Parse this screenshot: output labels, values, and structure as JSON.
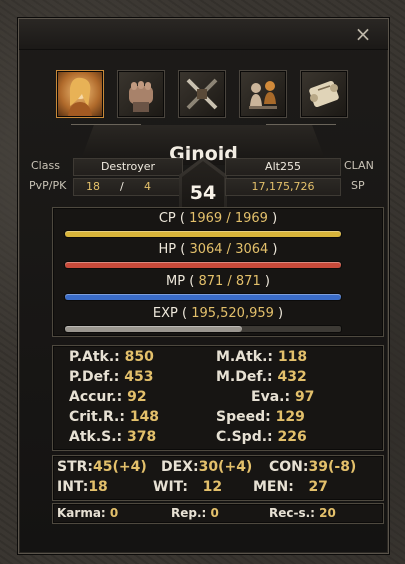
{
  "window": {
    "close_label": "×"
  },
  "tabs": [
    {
      "name": "character-portrait",
      "active": true
    },
    {
      "name": "fist",
      "active": false
    },
    {
      "name": "crossed-weapons",
      "active": false
    },
    {
      "name": "pawns",
      "active": false
    },
    {
      "name": "scroll",
      "active": false
    }
  ],
  "character": {
    "name": "Ginoid",
    "class_label": "Class",
    "class_value": "Destroyer",
    "pvppk_label": "PvP/PK",
    "pvp": "18",
    "pk_separator": "/",
    "pk": "4",
    "level": "54",
    "clan_value": "Alt255",
    "clan_label": "CLAN",
    "sp_value": "17,175,726",
    "sp_label": "SP"
  },
  "bars": {
    "cp": {
      "label": "CP (",
      "value": "1969 / 1969",
      "close": ")",
      "fraction": 1.0,
      "color": "#d8b43a"
    },
    "hp": {
      "label": "HP (",
      "value": "3064 / 3064",
      "close": ")",
      "fraction": 1.0,
      "color": "#c84a3a"
    },
    "mp": {
      "label": "MP (",
      "value": "871 / 871",
      "close": ")",
      "fraction": 1.0,
      "color": "#3a6cc8"
    },
    "exp": {
      "label": "EXP (",
      "value": "195,520,959",
      "close": ")",
      "fraction": 0.64,
      "color": "#9a968f"
    }
  },
  "combat": {
    "patk": {
      "label": "P.Atk.:",
      "value": "850"
    },
    "matk": {
      "label": "M.Atk.:",
      "value": "118"
    },
    "pdef": {
      "label": "P.Def.:",
      "value": "453"
    },
    "mdef": {
      "label": "M.Def.:",
      "value": "432"
    },
    "accur": {
      "label": "Accur.:",
      "value": "92"
    },
    "eva": {
      "label": "Eva.:",
      "value": "97"
    },
    "crit": {
      "label": "Crit.R.:",
      "value": "148"
    },
    "speed": {
      "label": "Speed:",
      "value": "129"
    },
    "atks": {
      "label": "Atk.S.:",
      "value": "378"
    },
    "cspd": {
      "label": "C.Spd.:",
      "value": "226"
    }
  },
  "base": {
    "str": {
      "label": "STR:",
      "value": "45(+4)"
    },
    "dex": {
      "label": "DEX:",
      "value": "30(+4)"
    },
    "con": {
      "label": "CON:",
      "value": "39(-8)"
    },
    "int": {
      "label": "INT:",
      "value": "18"
    },
    "wit": {
      "label": "WIT:",
      "value": "12"
    },
    "men": {
      "label": "MEN:",
      "value": "27"
    }
  },
  "social": {
    "karma": {
      "label": "Karma:",
      "value": "0"
    },
    "rep": {
      "label": "Rep.:",
      "value": "0"
    },
    "recs": {
      "label": "Rec-s.:",
      "value": "20"
    }
  }
}
